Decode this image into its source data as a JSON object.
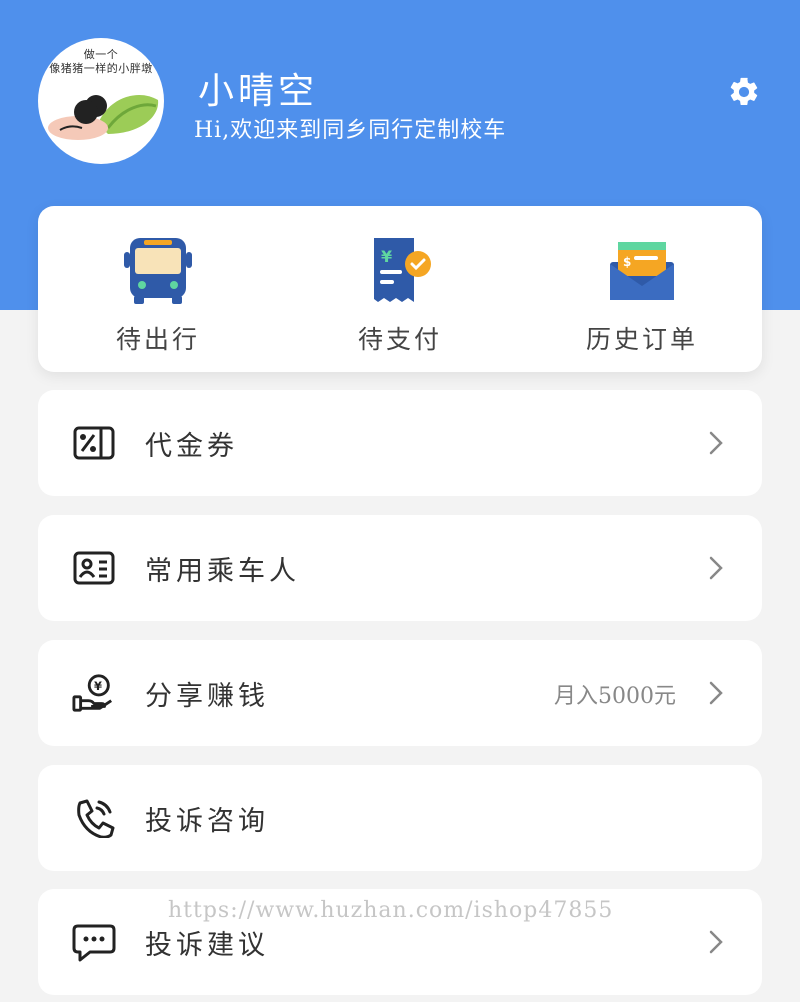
{
  "profile": {
    "avatar_caption": "做一个\n像猪猪一样的小胖墩",
    "name": "小晴空",
    "greeting": "Hi,欢迎来到同乡同行定制校车"
  },
  "orders": [
    {
      "label": "待出行",
      "icon": "bus-icon"
    },
    {
      "label": "待支付",
      "icon": "payment-receipt-icon"
    },
    {
      "label": "历史订单",
      "icon": "wallet-envelope-icon"
    }
  ],
  "menu": [
    {
      "label": "代金券",
      "icon": "coupon-icon",
      "extra": ""
    },
    {
      "label": "常用乘车人",
      "icon": "id-card-icon",
      "extra": ""
    },
    {
      "label": "分享赚钱",
      "icon": "money-hand-icon",
      "extra": "月入5000元"
    },
    {
      "label": "投诉咨询",
      "icon": "phone-icon",
      "extra": ""
    },
    {
      "label": "投诉建议",
      "icon": "chat-bubble-icon",
      "extra": ""
    }
  ],
  "watermark": "https://www.huzhan.com/ishop47855",
  "colors": {
    "header": "#4f90ec",
    "background": "#f3f3f3",
    "card": "#ffffff",
    "icon_blue": "#2f5aa8",
    "icon_orange": "#f5a623"
  }
}
